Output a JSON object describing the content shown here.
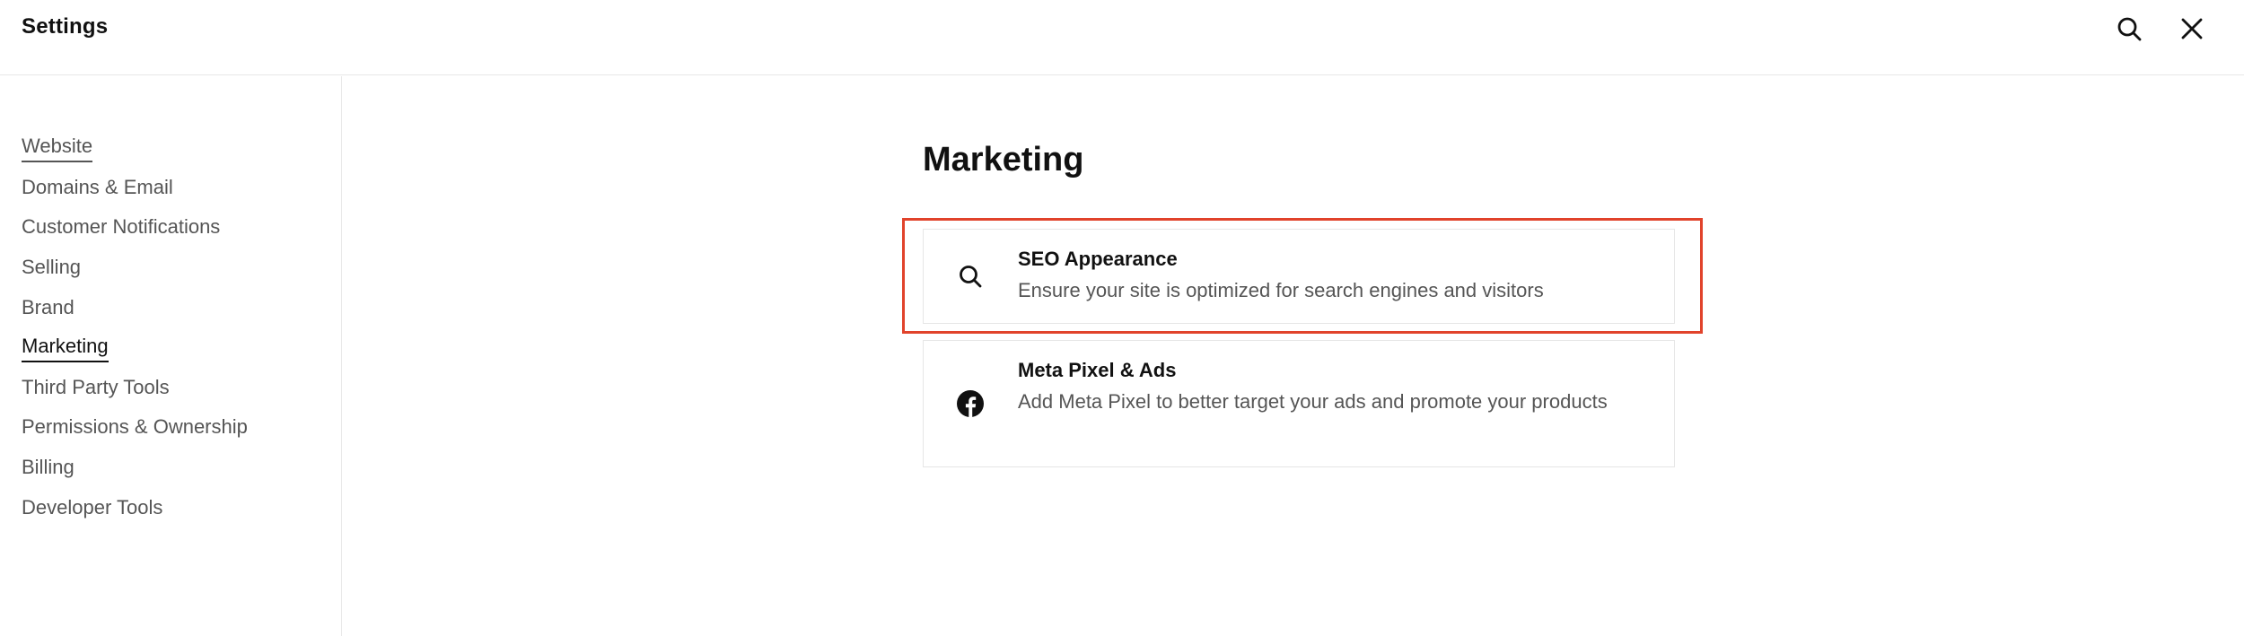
{
  "header": {
    "title": "Settings",
    "search_icon": "search-icon",
    "close_icon": "close-icon"
  },
  "sidebar": {
    "items": [
      {
        "label": "Website",
        "state": "underlined"
      },
      {
        "label": "Domains & Email",
        "state": "normal"
      },
      {
        "label": "Customer Notifications",
        "state": "normal"
      },
      {
        "label": "Selling",
        "state": "normal"
      },
      {
        "label": "Brand",
        "state": "normal"
      },
      {
        "label": "Marketing",
        "state": "active"
      },
      {
        "label": "Third Party Tools",
        "state": "normal"
      },
      {
        "label": "Permissions & Ownership",
        "state": "normal"
      },
      {
        "label": "Billing",
        "state": "normal"
      },
      {
        "label": "Developer Tools",
        "state": "normal"
      }
    ]
  },
  "main": {
    "title": "Marketing",
    "cards": [
      {
        "icon": "search-icon",
        "title": "SEO Appearance",
        "description": "Ensure your site is optimized for search engines and visitors",
        "highlighted": true
      },
      {
        "icon": "facebook-icon",
        "title": "Meta Pixel & Ads",
        "description": "Add Meta Pixel to better target your ads and promote your products",
        "highlighted": false
      }
    ]
  },
  "colors": {
    "highlight_border": "#e1432b",
    "text_primary": "#111111",
    "text_secondary": "#555555",
    "divider": "#e8e8e8"
  }
}
